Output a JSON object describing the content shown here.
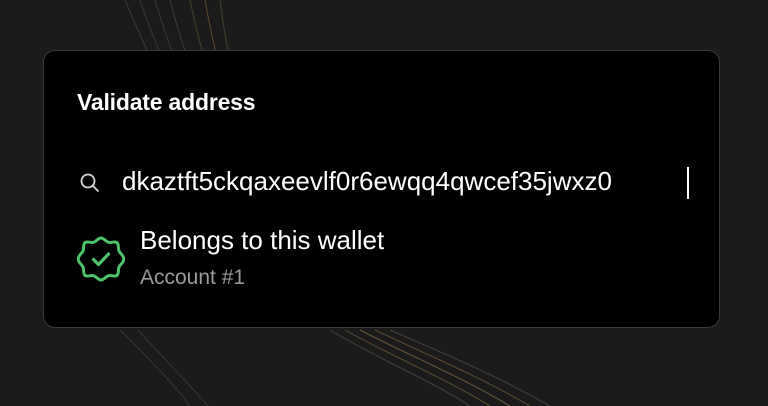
{
  "dialog": {
    "title": "Validate address"
  },
  "search": {
    "value": "dkaztft5ckqaxeevlf0r6ewqq4qwcef35jwxz0",
    "icon": "search-icon"
  },
  "result": {
    "status": "Belongs to this wallet",
    "account": "Account #1",
    "icon": "verified-badge-icon",
    "color": "#4cc46a"
  },
  "colors": {
    "background": "#1b1b1b",
    "card": "#000000",
    "border": "#3a3a3a",
    "text": "#ffffff",
    "muted": "#9a9a9a",
    "success": "#4cc46a"
  }
}
